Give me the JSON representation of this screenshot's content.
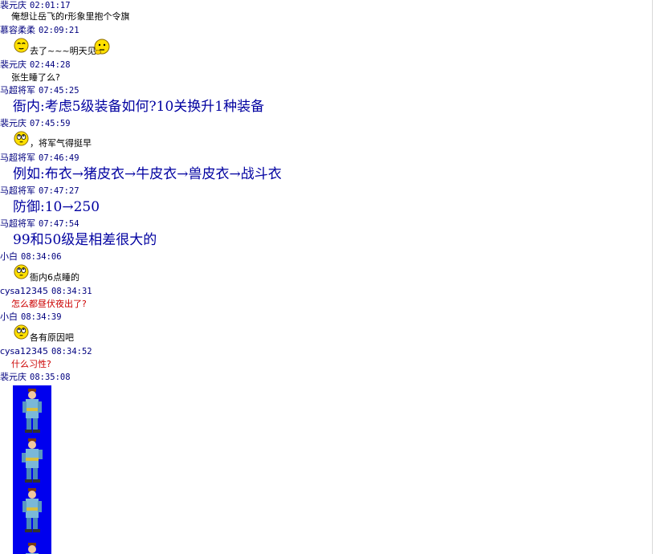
{
  "messages": [
    {
      "sender": "裴元庆",
      "time": "02:01:17",
      "text": "俺想让岳飞的r形象里抱个令旗"
    },
    {
      "sender": "慕容柔柔",
      "time": "02:09:21",
      "text": "去了~~~明天见",
      "icon_before": "sleepy-smiley-icon",
      "icon_after": "thinking-smiley-icon"
    },
    {
      "sender": "裴元庆",
      "time": "02:44:28",
      "text": "张生睡了么?"
    },
    {
      "sender": "马超将军",
      "time": "07:45:25",
      "text": "衙内:考虑5级装备如何?10关换升1种装备"
    },
    {
      "sender": "裴元庆",
      "time": "07:45:59",
      "text": "，将军气得挺早",
      "icon_before": "rolling-eyes-smiley-icon"
    },
    {
      "sender": "马超将军",
      "time": "07:46:49",
      "text": "例如:布衣→猪皮衣→牛皮衣→兽皮衣→战斗衣"
    },
    {
      "sender": "马超将军",
      "time": "07:47:27",
      "text": "防御:10→250"
    },
    {
      "sender": "马超将军",
      "time": "07:47:54",
      "text": "99和50级是相差很大的"
    },
    {
      "sender": "小白",
      "time": "08:34:06",
      "text": "衙内6点睡的",
      "icon_before": "rolling-eyes-smiley-icon"
    },
    {
      "sender": "cysa12345",
      "time": "08:34:31",
      "text": "怎么都昼伏夜出了?"
    },
    {
      "sender": "小白",
      "time": "08:34:39",
      "text": "各有原因吧",
      "icon_before": "rolling-eyes-smiley-icon"
    },
    {
      "sender": "cysa12345",
      "time": "08:34:52",
      "text": "什么习性?"
    },
    {
      "sender": "裴元庆",
      "time": "08:35:08",
      "image": "warrior-sprite-strip",
      "sprite_color": "#0000ee"
    }
  ]
}
